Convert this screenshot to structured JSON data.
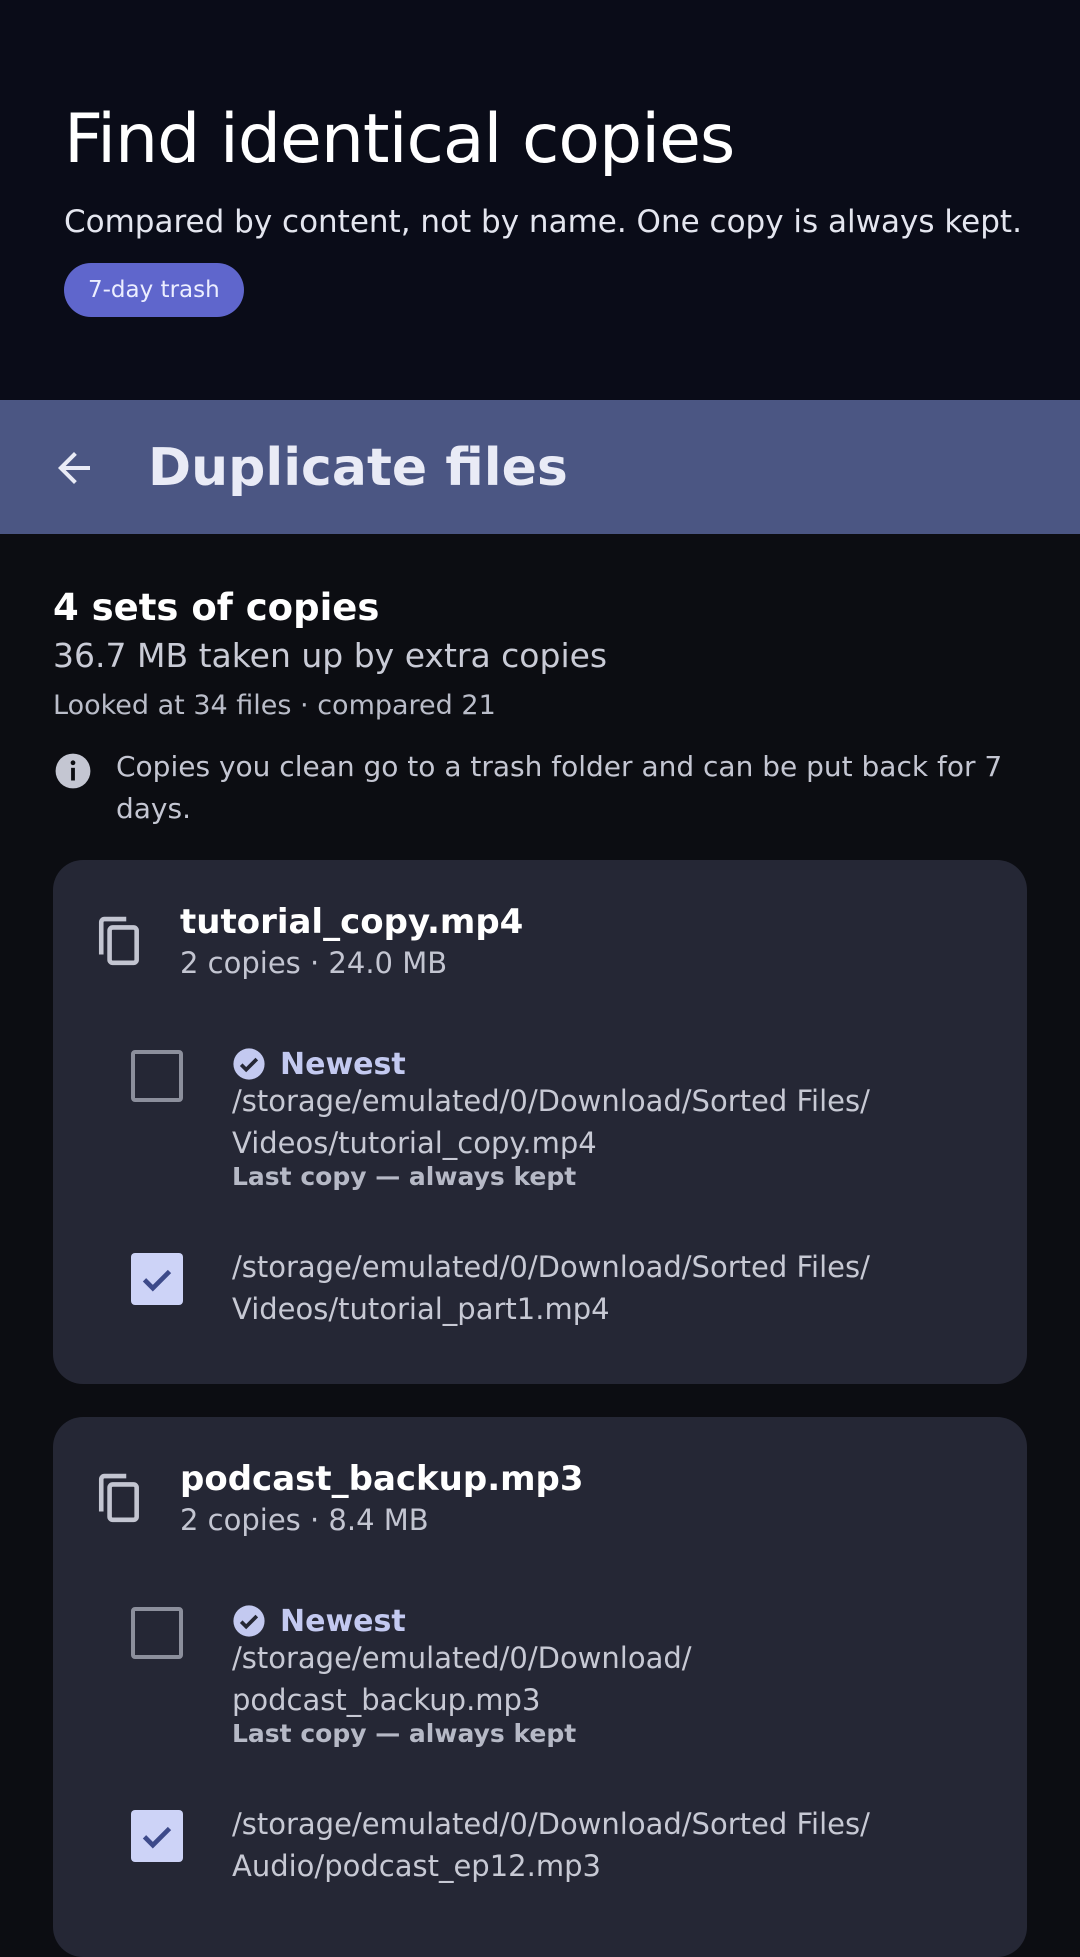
{
  "hero": {
    "title": "Find identical copies",
    "subtitle": "Compared by content, not by name. One copy is always kept.",
    "badge": "7-day trash"
  },
  "appbar": {
    "back_icon": "arrow-left-icon",
    "title": "Duplicate files"
  },
  "summary": {
    "title": "4 sets of copies",
    "size": "36.7 MB taken up by extra copies",
    "stats": "Looked at 34 files · compared 21",
    "info_icon": "info-icon",
    "info": "Copies you clean go to a trash folder and can be put back for 7 days."
  },
  "groups": [
    {
      "name": "tutorial_copy.mp4",
      "meta": "2 copies · 24.0 MB",
      "icon": "copy-icon",
      "files": [
        {
          "checked": false,
          "badge": "Newest",
          "path": "/storage/emulated/0/Download/Sorted Files/ Videos/tutorial_copy.mp4",
          "note": "Last copy — always kept"
        },
        {
          "checked": true,
          "path": "/storage/emulated/0/Download/Sorted Files/ Videos/tutorial_part1.mp4"
        }
      ]
    },
    {
      "name": "podcast_backup.mp3",
      "meta": "2 copies · 8.4 MB",
      "icon": "copy-icon",
      "files": [
        {
          "checked": false,
          "badge": "Newest",
          "path": "/storage/emulated/0/Download/ podcast_backup.mp3",
          "note": "Last copy — always kept"
        },
        {
          "checked": true,
          "path": "/storage/emulated/0/Download/Sorted Files/ Audio/podcast_ep12.mp3"
        }
      ]
    }
  ],
  "colors": {
    "hero_bg": "#0a0c18",
    "appbar_bg": "#4b5683",
    "accent": "#5f66cc",
    "card_bg": "#252735",
    "checkbox_checked": "#cdd3f7"
  }
}
